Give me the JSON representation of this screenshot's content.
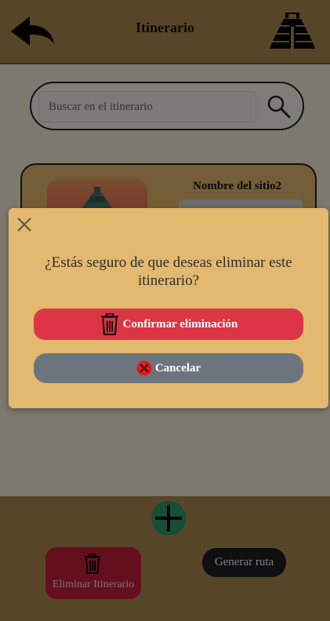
{
  "header": {
    "title": "Itinerario",
    "back_icon": "back-arrow-icon",
    "logo_icon": "pyramid-logo-icon"
  },
  "search": {
    "placeholder": "Buscar en el itinerario",
    "value": "",
    "icon": "search-icon"
  },
  "itinerary_card": {
    "site_name": "Nombre del sitio2"
  },
  "footer": {
    "add_icon": "plus-icon",
    "delete_label": "Eliminar Itinerario",
    "route_label": "Generar ruta"
  },
  "modal": {
    "message": "¿Estás seguro de que deseas eliminar este itinerario?",
    "confirm_label": "Confirmar eliminación",
    "cancel_label": "Cancelar"
  },
  "colors": {
    "header_bg": "#ae8a4e",
    "content_bg": "#fbf2dd",
    "modal_bg": "#e2b96f",
    "danger": "#dc3545",
    "secondary": "#6c757d",
    "add_button": "#2f9a72",
    "dark_button": "#1c1e22"
  }
}
